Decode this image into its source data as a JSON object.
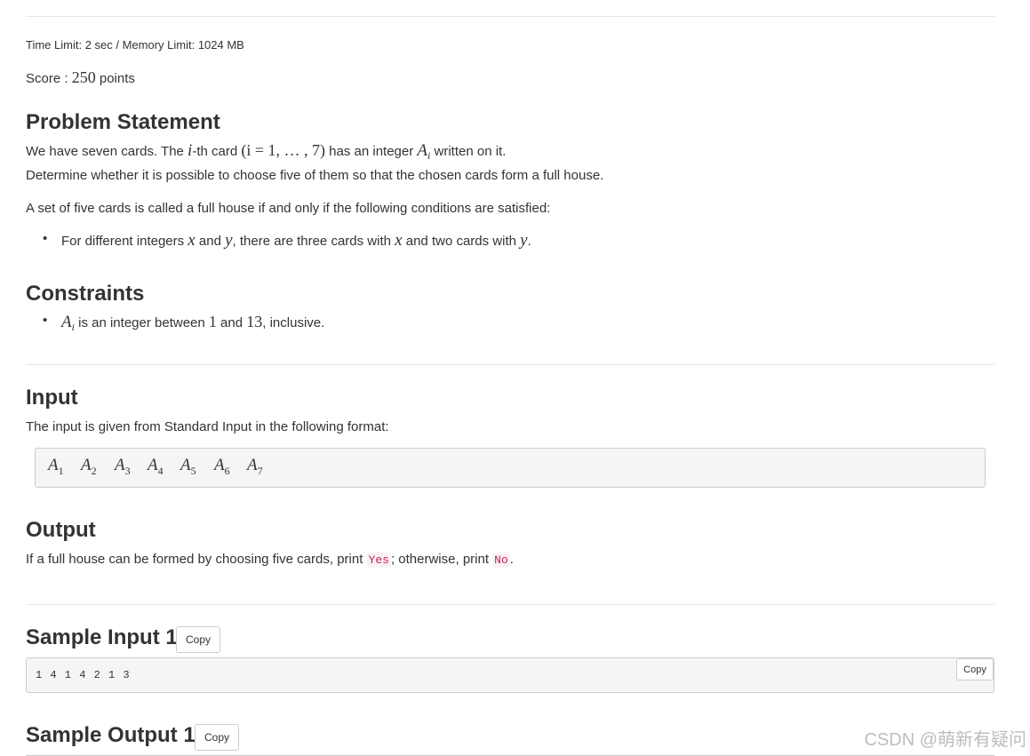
{
  "meta": "Time Limit: 2 sec / Memory Limit: 1024 MB",
  "score": {
    "prefix": "Score : ",
    "value": "250",
    "suffix": " points"
  },
  "problem": {
    "heading": "Problem Statement",
    "line1": {
      "a": "We have seven cards. The ",
      "var_i": "i",
      "b": "-th card ",
      "range": "(i = 1, … , 7)",
      "c": " has an integer ",
      "var_A": "A",
      "sub": "i",
      "d": " written on it."
    },
    "line2": "Determine whether it is possible to choose five of them so that the chosen cards form a full house.",
    "line3": "A set of five cards is called a full house if and only if the following conditions are satisfied:",
    "bullet": {
      "a": "For different integers ",
      "x": "x",
      "b": " and ",
      "y": "y",
      "c": ", there are three cards with ",
      "x2": "x",
      "d": " and two cards with ",
      "y2": "y",
      "e": "."
    }
  },
  "constraints": {
    "heading": "Constraints",
    "bullet": {
      "var_A": "A",
      "sub": "i",
      "a": " is an integer between ",
      "n1": "1",
      "b": " and ",
      "n2": "13",
      "c": ", inclusive."
    }
  },
  "input": {
    "heading": "Input",
    "text": "The input is given from Standard Input in the following format:",
    "format": [
      {
        "v": "A",
        "s": "1"
      },
      {
        "v": "A",
        "s": "2"
      },
      {
        "v": "A",
        "s": "3"
      },
      {
        "v": "A",
        "s": "4"
      },
      {
        "v": "A",
        "s": "5"
      },
      {
        "v": "A",
        "s": "6"
      },
      {
        "v": "A",
        "s": "7"
      }
    ]
  },
  "output": {
    "heading": "Output",
    "a": "If a full house can be formed by choosing five cards, print ",
    "yes": "Yes",
    "b": "; otherwise, print ",
    "no": "No",
    "c": "."
  },
  "sample_input_1": {
    "heading": "Sample Input 1",
    "copy": "Copy",
    "pre_copy": "Copy",
    "content": "1 4 1 4 2 1 3"
  },
  "sample_output_1": {
    "heading": "Sample Output 1",
    "copy": "Copy"
  },
  "watermark": "CSDN @萌新有疑问"
}
